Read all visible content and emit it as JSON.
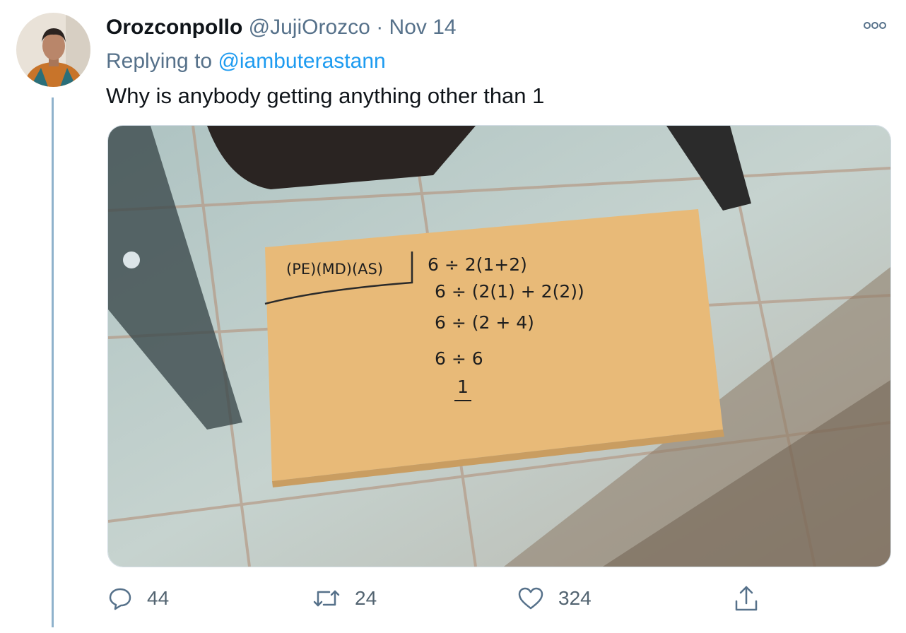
{
  "tweet": {
    "display_name": "Orozconpollo",
    "handle": "@JujiOrozco",
    "separator": "·",
    "date": "Nov 14",
    "replying_prefix": "Replying to",
    "replying_to": "@iambuterastann",
    "text": "Why is anybody getting anything other than 1",
    "more_icon": "more-options-icon"
  },
  "photo": {
    "card_header": "(PE)(MD)(AS)",
    "steps": [
      "6 ÷ 2(1+2)",
      "6 ÷ (2(1) + 2(2))",
      "6 ÷ (2 + 4)",
      "6 ÷ 6",
      "1"
    ]
  },
  "actions": {
    "reply": {
      "icon": "reply-icon",
      "count": "44"
    },
    "retweet": {
      "icon": "retweet-icon",
      "count": "24"
    },
    "like": {
      "icon": "like-icon",
      "count": "324"
    },
    "share": {
      "icon": "share-icon"
    }
  },
  "colors": {
    "link": "#1d9bf0",
    "secondary": "#56718a",
    "thread_line": "#8fb2cc"
  }
}
